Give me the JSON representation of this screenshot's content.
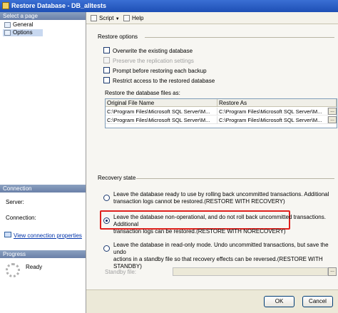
{
  "window": {
    "title": "Restore Database - DB_alltests"
  },
  "sidebar": {
    "select_page_header": "Select a page",
    "items": [
      {
        "label": "General",
        "selected": false
      },
      {
        "label": "Options",
        "selected": true
      }
    ],
    "connection_header": "Connection",
    "server_label": "Server:",
    "connection_label": "Connection:",
    "view_connection_link": "View connection properties",
    "progress_header": "Progress",
    "progress_status": "Ready"
  },
  "toolbar": {
    "script_label": "Script",
    "help_label": "Help"
  },
  "restore_options": {
    "header": "Restore options",
    "checkboxes": [
      {
        "label": "Overwrite the existing database",
        "checked": false,
        "enabled": true
      },
      {
        "label": "Preserve the replication settings",
        "checked": false,
        "enabled": false
      },
      {
        "label": "Prompt before restoring each backup",
        "checked": false,
        "enabled": true
      },
      {
        "label": "Restrict access to the restored database",
        "checked": false,
        "enabled": true
      }
    ],
    "files_label": "Restore the database files as:",
    "table": {
      "columns": [
        "Original File Name",
        "Restore As"
      ],
      "rows": [
        [
          "C:\\Program Files\\Microsoft SQL Server\\M...",
          "C:\\Program Files\\Microsoft SQL Server\\M..."
        ],
        [
          "C:\\Program Files\\Microsoft SQL Server\\M...",
          "C:\\Program Files\\Microsoft SQL Server\\M..."
        ]
      ],
      "browse_label": "..."
    }
  },
  "recovery_state": {
    "header": "Recovery state",
    "options": [
      {
        "line1": "Leave the database ready to use by rolling back uncommitted transactions. Additional",
        "line2": "transaction logs cannot be restored.(RESTORE WITH RECOVERY)",
        "selected": false
      },
      {
        "line1": "Leave the database non-operational, and do not roll back uncommitted transactions. Additional",
        "line2": "transaction logs can be restored.(RESTORE WITH NORECOVERY)",
        "selected": true
      },
      {
        "line1": "Leave the database in read-only mode. Undo uncommitted transactions, but save the undo",
        "line2": "actions in a standby file so that recovery effects can be reversed.(RESTORE WITH STANDBY)",
        "selected": false
      }
    ],
    "standby_label": "Standby file:",
    "standby_value": "",
    "browse_label": "..."
  },
  "buttons": {
    "ok": "OK",
    "cancel": "Cancel"
  }
}
